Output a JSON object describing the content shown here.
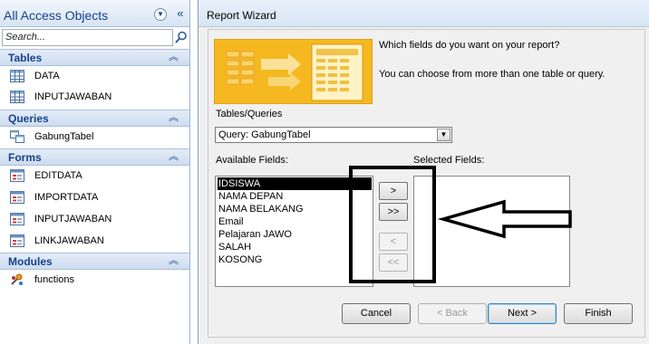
{
  "nav": {
    "title": "All Access Objects",
    "search_placeholder": "Search...",
    "groups": [
      {
        "label": "Tables",
        "items": [
          "DATA",
          "INPUTJAWABAN"
        ]
      },
      {
        "label": "Queries",
        "items": [
          "GabungTabel"
        ]
      },
      {
        "label": "Forms",
        "items": [
          "EDITDATA",
          "IMPORTDATA",
          "INPUTJAWABAN",
          "LINKJAWABAN"
        ]
      },
      {
        "label": "Modules",
        "items": [
          "functions"
        ]
      }
    ]
  },
  "dialog": {
    "title": "Report Wizard",
    "question": "Which fields do you want on your report?",
    "hint": "You can choose from more than one table or query.",
    "tables_queries_label": "Tables/Queries",
    "tables_queries_value": "Query: GabungTabel",
    "available_label": "Available Fields:",
    "selected_label": "Selected Fields:",
    "available_fields": [
      "IDSISWA",
      "NAMA DEPAN",
      "NAMA BELAKANG",
      "Email",
      "Pelajaran JAWO",
      "SALAH",
      "KOSONG"
    ],
    "selected_field_index": 0,
    "buttons": {
      "add_one": ">",
      "add_all": ">>",
      "remove_one": "<",
      "remove_all": "<<",
      "cancel": "Cancel",
      "back": "< Back",
      "next": "Next >",
      "finish": "Finish"
    }
  },
  "colors": {
    "nav_header_text": "#15428b",
    "selection": "#000000",
    "wizard_image_bg": "#f5b820",
    "annotation": "#000000"
  }
}
